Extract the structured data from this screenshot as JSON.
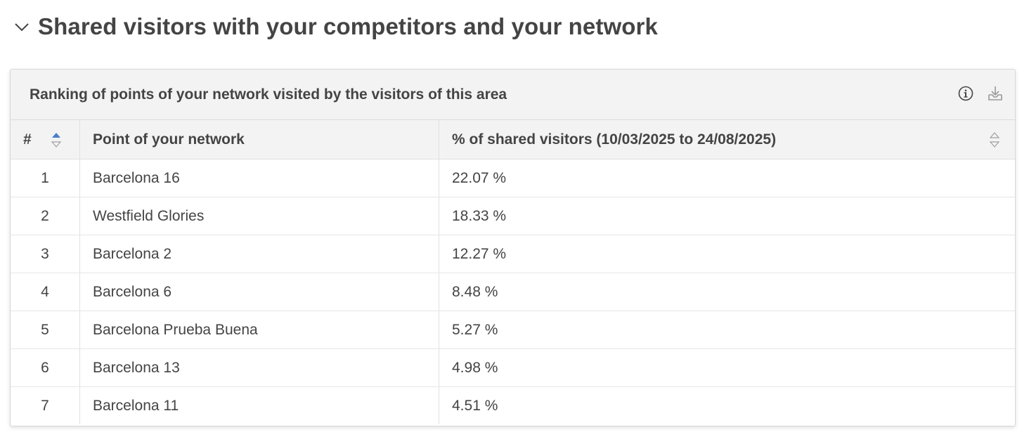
{
  "section": {
    "title": "Shared visitors with your competitors and your network"
  },
  "card": {
    "title": "Ranking of points of your network visited by the visitors of this area"
  },
  "table": {
    "columns": [
      "#",
      "Point of your network",
      "% of shared visitors (10/03/2025 to 24/08/2025)"
    ],
    "rows": [
      {
        "rank": "1",
        "point": "Barcelona 16",
        "pct": "22.07 %"
      },
      {
        "rank": "2",
        "point": "Westfield Glories",
        "pct": "18.33 %"
      },
      {
        "rank": "3",
        "point": "Barcelona 2",
        "pct": "12.27 %"
      },
      {
        "rank": "4",
        "point": "Barcelona 6",
        "pct": "8.48 %"
      },
      {
        "rank": "5",
        "point": "Barcelona Prueba Buena",
        "pct": "5.27 %"
      },
      {
        "rank": "6",
        "point": "Barcelona 13",
        "pct": "4.98 %"
      },
      {
        "rank": "7",
        "point": "Barcelona 11",
        "pct": "4.51 %"
      }
    ]
  },
  "colors": {
    "sort_active": "#4a7fc9",
    "sort_inactive": "#a0a0a0"
  },
  "icons": [
    "chevron-down-icon",
    "info-icon",
    "download-icon",
    "sort-asc-icon",
    "sort-icon"
  ]
}
